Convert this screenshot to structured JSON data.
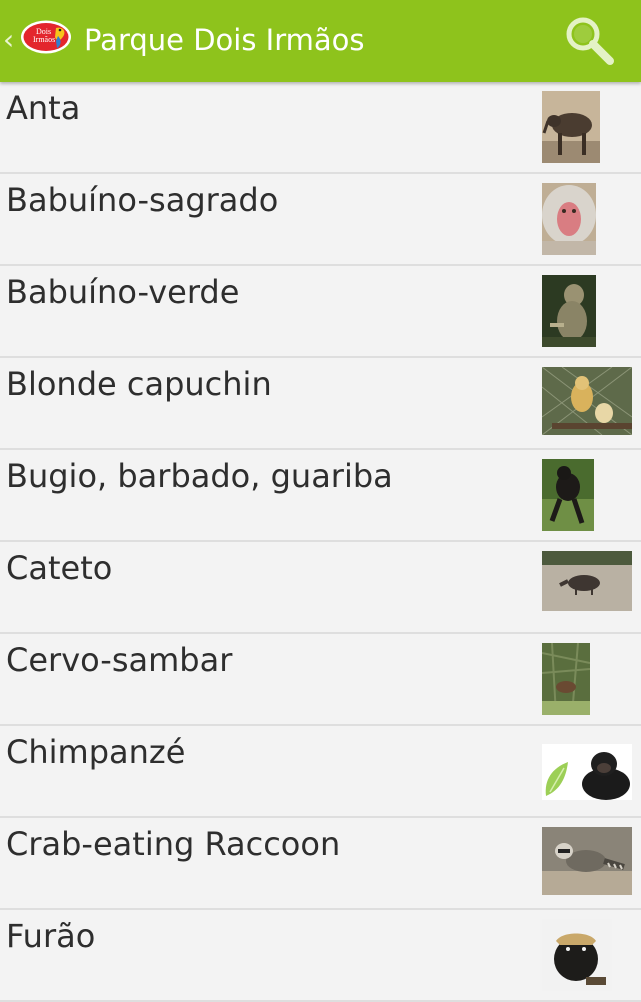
{
  "app": {
    "title": "Parque Dois Irmãos",
    "logo_text_1": "Dois",
    "logo_text_2": "Irmãos",
    "accent": "#8ec31c"
  },
  "icons": {
    "back": "chevron-left-icon",
    "search": "search-icon"
  },
  "animals": [
    {
      "name": "Anta",
      "thumb": "tapir"
    },
    {
      "name": "Babuíno-sagrado",
      "thumb": "hamadryas-baboon"
    },
    {
      "name": "Babuíno-verde",
      "thumb": "olive-baboon"
    },
    {
      "name": "Blonde capuchin",
      "thumb": "capuchin-monkeys"
    },
    {
      "name": "Bugio, barbado, guariba",
      "thumb": "howler-monkey"
    },
    {
      "name": "Cateto",
      "thumb": "peccary"
    },
    {
      "name": "Cervo-sambar",
      "thumb": "sambar-deer"
    },
    {
      "name": "Chimpanzé",
      "thumb": "chimpanzee"
    },
    {
      "name": "Crab-eating Raccoon",
      "thumb": "crab-eating-raccoon"
    },
    {
      "name": "Furão",
      "thumb": "grison"
    }
  ]
}
